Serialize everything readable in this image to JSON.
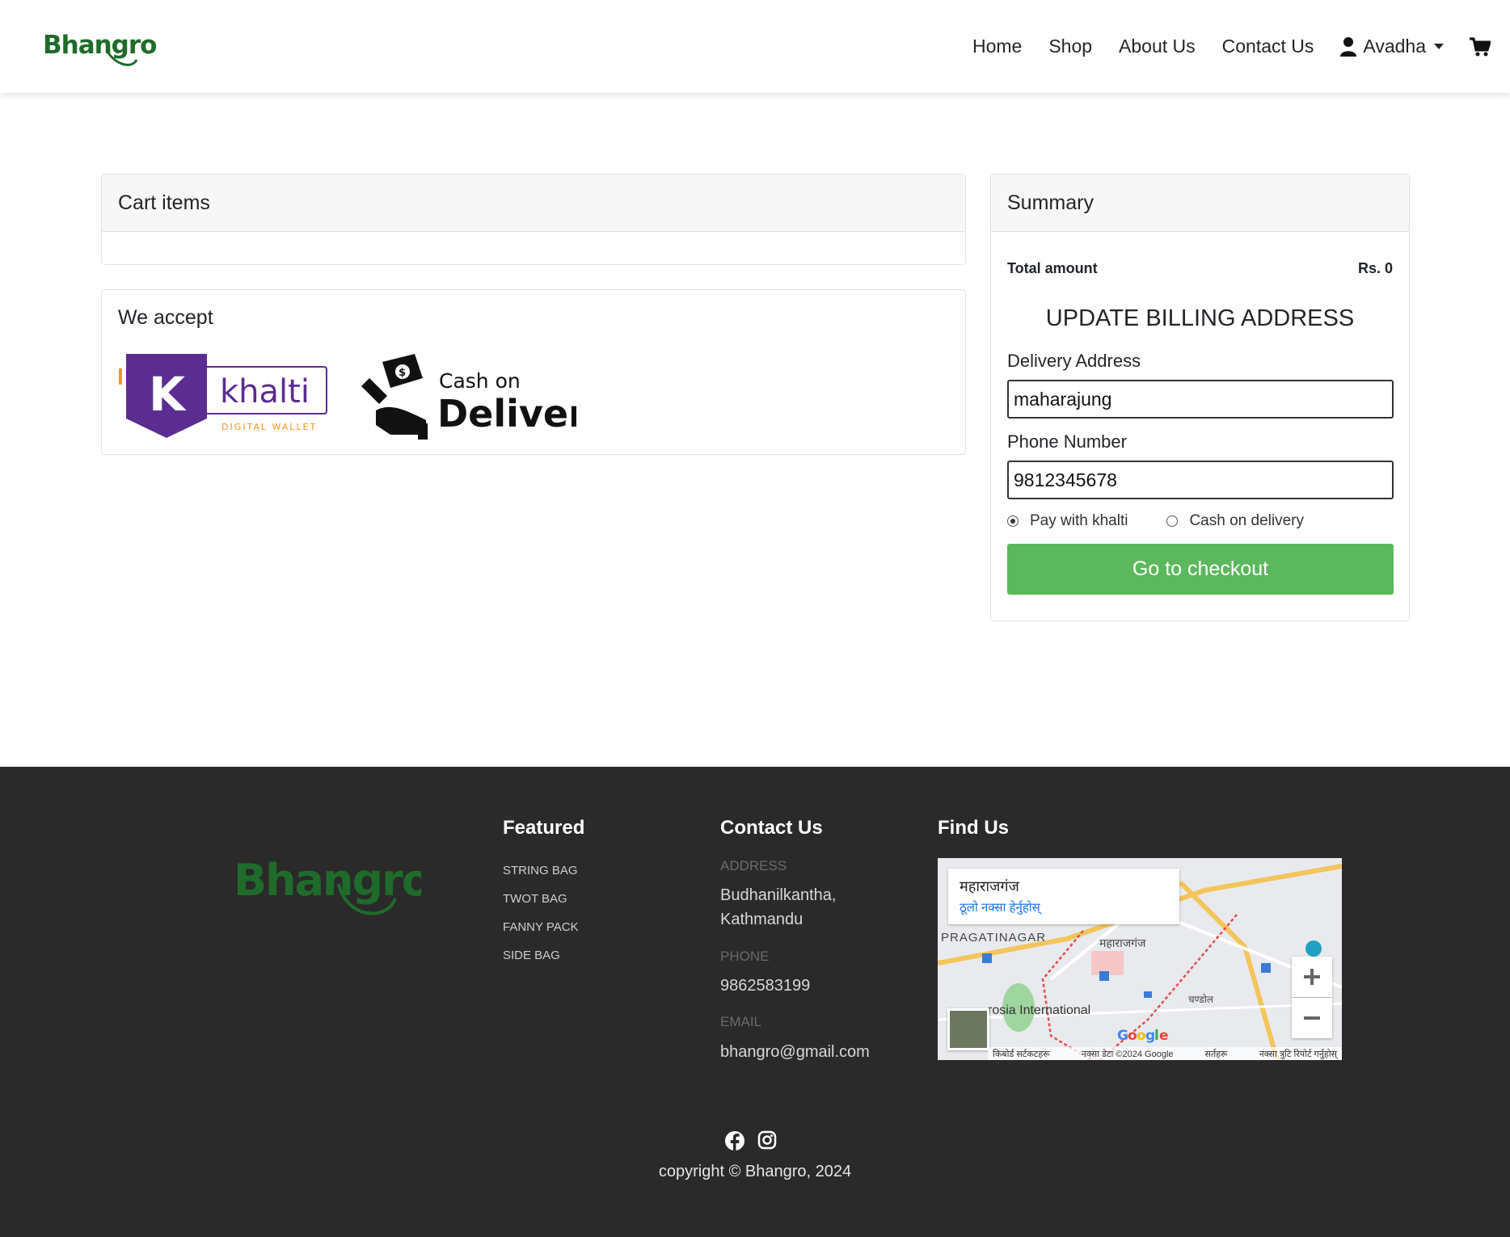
{
  "nav": {
    "brand": "Bhangro",
    "links": [
      "Home",
      "Shop",
      "About Us",
      "Contact Us"
    ],
    "user": "Avadha"
  },
  "cart": {
    "title": "Cart items"
  },
  "accept": {
    "title": "We accept",
    "khalti_logo": {
      "name": "khalti",
      "tagline": "DIGITAL WALLET"
    },
    "cod_logo": {
      "line1": "Cash on",
      "line2": "Delivery"
    }
  },
  "summary": {
    "title": "Summary",
    "total_label": "Total amount",
    "total_value": "Rs. 0",
    "billing_title": "UPDATE BILLING ADDRESS",
    "address_label": "Delivery Address",
    "address_value": "maharajung",
    "phone_label": "Phone Number",
    "phone_value": "9812345678",
    "payment_options": [
      {
        "label": "Pay with khalti",
        "selected": true
      },
      {
        "label": "Cash on delivery",
        "selected": false
      }
    ],
    "checkout_label": "Go to checkout"
  },
  "footer": {
    "brand": "Bhangro",
    "featured_title": "Featured",
    "featured_items": [
      "STRING BAG",
      "TWOT BAG",
      "FANNY PACK",
      "SIDE BAG"
    ],
    "contact_title": "Contact Us",
    "address_label": "ADDRESS",
    "address_line1": "Budhanilkantha,",
    "address_line2": "Kathmandu",
    "phone_label": "PHONE",
    "phone_value": "9862583199",
    "email_label": "EMAIL",
    "email_value": "bhangro@gmail.com",
    "find_title": "Find Us",
    "map": {
      "place": "महाराजगंज",
      "link": "ठूलो नक्सा हेर्नुहोस्",
      "label_area": "PRAGATINAGAR",
      "label_center": "महाराजगंज",
      "label_poi": "rosia International",
      "label_chok": "चण्डोल",
      "footer_items": [
        "किबोर्ड सर्टकटहरू",
        "नक्सा डेटा ©2024 Google",
        "सर्तहरू",
        "नक्सा त्रुटि रिपोर्ट गर्नुहोस्"
      ]
    },
    "copyright": "copyright © Bhangro, 2024"
  },
  "colors": {
    "brand_green": "#1f6b2a",
    "checkout_green": "#5cb85c",
    "footer_bg": "#2a2a2a",
    "khalti_purple": "#5c2d91"
  }
}
